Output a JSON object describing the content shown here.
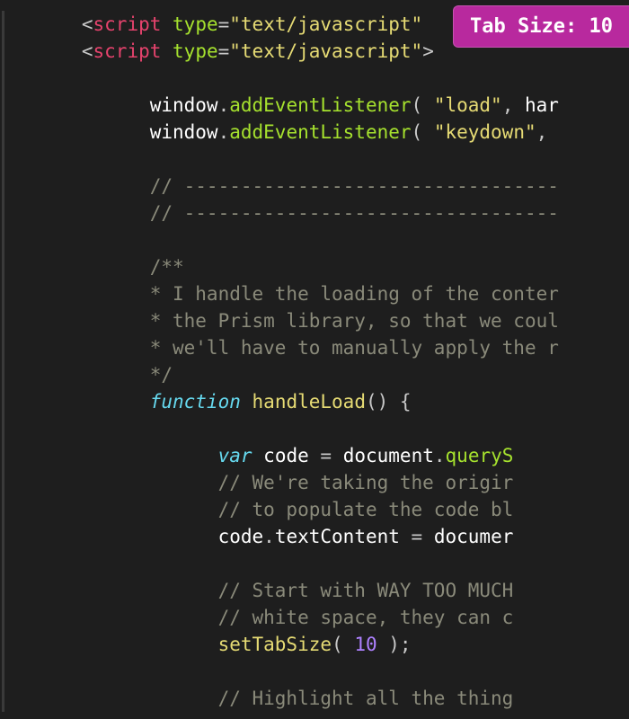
{
  "badge": {
    "label": "Tab Size: 10"
  },
  "lines": [
    {
      "segs": [
        {
          "cls": "",
          "t": "      "
        },
        {
          "cls": "punct",
          "t": "<"
        },
        {
          "cls": "tag",
          "t": "script"
        },
        {
          "cls": "",
          "t": " "
        },
        {
          "cls": "attr-name",
          "t": "type"
        },
        {
          "cls": "punct",
          "t": "="
        },
        {
          "cls": "attr-value",
          "t": "\"text/javascript\""
        },
        {
          "cls": "",
          "t": " "
        }
      ]
    },
    {
      "segs": [
        {
          "cls": "",
          "t": "      "
        },
        {
          "cls": "punct",
          "t": "<"
        },
        {
          "cls": "tag",
          "t": "script"
        },
        {
          "cls": "",
          "t": " "
        },
        {
          "cls": "attr-name",
          "t": "type"
        },
        {
          "cls": "punct",
          "t": "="
        },
        {
          "cls": "attr-value",
          "t": "\"text/javascript\""
        },
        {
          "cls": "punct",
          "t": ">"
        }
      ]
    },
    {
      "segs": [
        {
          "cls": "",
          "t": " "
        }
      ]
    },
    {
      "segs": [
        {
          "cls": "",
          "t": "            "
        },
        {
          "cls": "ident",
          "t": "window"
        },
        {
          "cls": "punct",
          "t": "."
        },
        {
          "cls": "method",
          "t": "addEventListener"
        },
        {
          "cls": "punct",
          "t": "( "
        },
        {
          "cls": "string",
          "t": "\"load\""
        },
        {
          "cls": "punct",
          "t": ", "
        },
        {
          "cls": "ident",
          "t": "har"
        }
      ]
    },
    {
      "segs": [
        {
          "cls": "",
          "t": "            "
        },
        {
          "cls": "ident",
          "t": "window"
        },
        {
          "cls": "punct",
          "t": "."
        },
        {
          "cls": "method",
          "t": "addEventListener"
        },
        {
          "cls": "punct",
          "t": "( "
        },
        {
          "cls": "string",
          "t": "\"keydown\""
        },
        {
          "cls": "punct",
          "t": ","
        }
      ]
    },
    {
      "segs": [
        {
          "cls": "",
          "t": " "
        }
      ]
    },
    {
      "segs": [
        {
          "cls": "",
          "t": "            "
        },
        {
          "cls": "comment",
          "t": "// ---------------------------------"
        }
      ]
    },
    {
      "segs": [
        {
          "cls": "",
          "t": "            "
        },
        {
          "cls": "comment",
          "t": "// ---------------------------------"
        }
      ]
    },
    {
      "segs": [
        {
          "cls": "",
          "t": " "
        }
      ]
    },
    {
      "segs": [
        {
          "cls": "",
          "t": "            "
        },
        {
          "cls": "comment",
          "t": "/**"
        }
      ]
    },
    {
      "segs": [
        {
          "cls": "",
          "t": "            "
        },
        {
          "cls": "comment",
          "t": "* I handle the loading of the conter"
        }
      ]
    },
    {
      "segs": [
        {
          "cls": "",
          "t": "            "
        },
        {
          "cls": "comment",
          "t": "* the Prism library, so that we coul"
        }
      ]
    },
    {
      "segs": [
        {
          "cls": "",
          "t": "            "
        },
        {
          "cls": "comment",
          "t": "* we'll have to manually apply the r"
        }
      ]
    },
    {
      "segs": [
        {
          "cls": "",
          "t": "            "
        },
        {
          "cls": "comment",
          "t": "*/"
        }
      ]
    },
    {
      "segs": [
        {
          "cls": "",
          "t": "            "
        },
        {
          "cls": "keyword",
          "t": "function"
        },
        {
          "cls": "",
          "t": " "
        },
        {
          "cls": "func",
          "t": "handleLoad"
        },
        {
          "cls": "punct",
          "t": "() {"
        }
      ]
    },
    {
      "segs": [
        {
          "cls": "",
          "t": " "
        }
      ]
    },
    {
      "segs": [
        {
          "cls": "",
          "t": "                  "
        },
        {
          "cls": "decl",
          "t": "var"
        },
        {
          "cls": "",
          "t": " "
        },
        {
          "cls": "ident",
          "t": "code"
        },
        {
          "cls": "",
          "t": " "
        },
        {
          "cls": "punct",
          "t": "="
        },
        {
          "cls": "",
          "t": " "
        },
        {
          "cls": "ident",
          "t": "document"
        },
        {
          "cls": "punct",
          "t": "."
        },
        {
          "cls": "method",
          "t": "queryS"
        }
      ]
    },
    {
      "segs": [
        {
          "cls": "",
          "t": "                  "
        },
        {
          "cls": "comment",
          "t": "// We're taking the origir"
        }
      ]
    },
    {
      "segs": [
        {
          "cls": "",
          "t": "                  "
        },
        {
          "cls": "comment",
          "t": "// to populate the code bl"
        }
      ]
    },
    {
      "segs": [
        {
          "cls": "",
          "t": "                  "
        },
        {
          "cls": "ident",
          "t": "code"
        },
        {
          "cls": "punct",
          "t": "."
        },
        {
          "cls": "prop",
          "t": "textContent"
        },
        {
          "cls": "",
          "t": " "
        },
        {
          "cls": "punct",
          "t": "="
        },
        {
          "cls": "",
          "t": " "
        },
        {
          "cls": "ident",
          "t": "documer"
        }
      ]
    },
    {
      "segs": [
        {
          "cls": "",
          "t": " "
        }
      ]
    },
    {
      "segs": [
        {
          "cls": "",
          "t": "                  "
        },
        {
          "cls": "comment",
          "t": "// Start with WAY TOO MUCH"
        }
      ]
    },
    {
      "segs": [
        {
          "cls": "",
          "t": "                  "
        },
        {
          "cls": "comment",
          "t": "// white space, they can c"
        }
      ]
    },
    {
      "segs": [
        {
          "cls": "",
          "t": "                  "
        },
        {
          "cls": "func",
          "t": "setTabSize"
        },
        {
          "cls": "punct",
          "t": "( "
        },
        {
          "cls": "num",
          "t": "10"
        },
        {
          "cls": "punct",
          "t": " );"
        }
      ]
    },
    {
      "segs": [
        {
          "cls": "",
          "t": " "
        }
      ]
    },
    {
      "segs": [
        {
          "cls": "",
          "t": "                  "
        },
        {
          "cls": "comment",
          "t": "// Highlight all the thing"
        }
      ]
    }
  ]
}
